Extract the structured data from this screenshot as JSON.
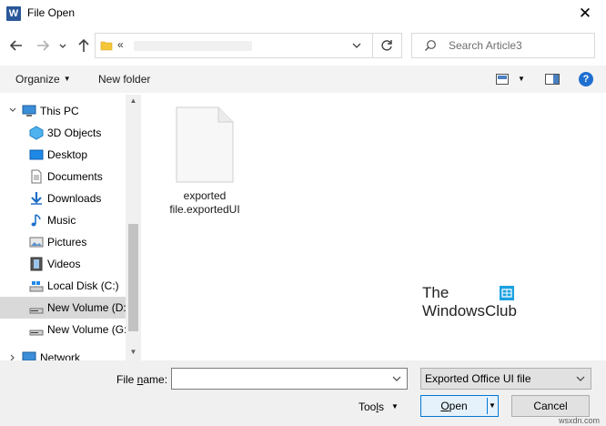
{
  "window": {
    "title": "File Open",
    "close_glyph": "✕"
  },
  "nav": {
    "back_icon": "arrow-left-icon",
    "forward_icon": "arrow-right-icon",
    "recent_icon": "chevron-down-icon",
    "up_icon": "arrow-up-icon",
    "address_prefix": "«",
    "refresh_icon": "refresh-icon",
    "search_placeholder": "Search Article3"
  },
  "toolbar": {
    "organize": "Organize",
    "organize_caret": "▼",
    "new_folder": "New folder",
    "view_caret": "▼",
    "help": "?"
  },
  "sidebar": {
    "items": [
      {
        "label": "This PC",
        "icon": "computer-icon"
      },
      {
        "label": "3D Objects",
        "icon": "3d-objects-icon"
      },
      {
        "label": "Desktop",
        "icon": "desktop-icon"
      },
      {
        "label": "Documents",
        "icon": "documents-icon"
      },
      {
        "label": "Downloads",
        "icon": "downloads-icon"
      },
      {
        "label": "Music",
        "icon": "music-icon"
      },
      {
        "label": "Pictures",
        "icon": "pictures-icon"
      },
      {
        "label": "Videos",
        "icon": "videos-icon"
      },
      {
        "label": "Local Disk (C:)",
        "icon": "local-disk-icon"
      },
      {
        "label": "New Volume (D:",
        "icon": "drive-icon",
        "selected": true
      },
      {
        "label": "New Volume (G:",
        "icon": "drive-icon"
      },
      {
        "label": "Network",
        "icon": "network-icon"
      }
    ]
  },
  "content": {
    "files": [
      {
        "line1": "exported",
        "line2": "file.exportedUI"
      }
    ],
    "watermark": {
      "line1": "The",
      "line2": "WindowsClub"
    }
  },
  "bottom": {
    "file_name_label_pre": "File ",
    "file_name_label_u": "n",
    "file_name_label_post": "ame:",
    "file_name_value": "",
    "file_type": "Exported Office UI file",
    "tools_pre": "Too",
    "tools_u": "l",
    "tools_post": "s",
    "tools_caret": "▼",
    "open_u": "O",
    "open_post": "pen",
    "open_caret": "▼",
    "cancel": "Cancel"
  },
  "credit": "wsxdn.com",
  "colors": {
    "accent": "#0078d7",
    "word_brand": "#2b579a",
    "help_blue": "#1f6fd1"
  }
}
